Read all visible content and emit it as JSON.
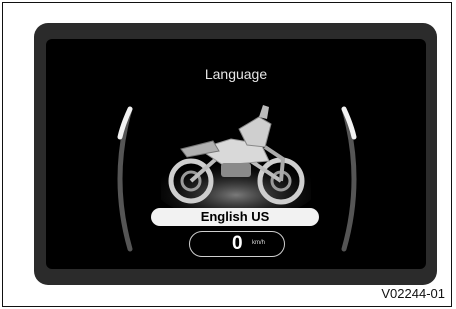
{
  "screen": {
    "title": "Language",
    "selected_language": "English US",
    "speed": {
      "value": "0",
      "unit": "km/h"
    }
  },
  "figure": {
    "caption": "V02244-01"
  },
  "icons": {
    "bike": "motorcycle-illustration",
    "left_gauge": "left-arc-gauge-icon",
    "right_gauge": "right-arc-gauge-icon"
  },
  "colors": {
    "screen_bg": "#000000",
    "bezel": "#2b2b2b",
    "text": "#e6e6e6"
  }
}
